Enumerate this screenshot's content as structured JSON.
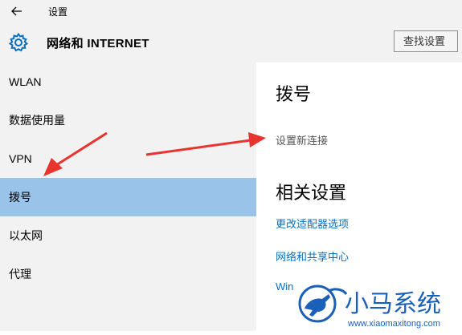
{
  "window": {
    "title": "设置"
  },
  "header": {
    "title": "网络和 INTERNET",
    "search_placeholder": "查找设置"
  },
  "sidebar": {
    "items": [
      {
        "label": "WLAN",
        "selected": false
      },
      {
        "label": "数据使用量",
        "selected": false
      },
      {
        "label": "VPN",
        "selected": false
      },
      {
        "label": "拨号",
        "selected": true
      },
      {
        "label": "以太网",
        "selected": false
      },
      {
        "label": "代理",
        "selected": false
      }
    ]
  },
  "main": {
    "section_title": "拨号",
    "setup_link": "设置新连接",
    "related_title": "相关设置",
    "related_links": [
      "更改适配器选项",
      "网络和共享中心",
      "Win"
    ]
  },
  "watermark": {
    "brand": "小马系统",
    "url": "www.xiaomaxitong.com"
  },
  "colors": {
    "selected_bg": "#99c3e8",
    "link": "#0a6ebd",
    "arrow": "#e8342f",
    "sidebar_bg": "#f2f2f2"
  },
  "icons": {
    "back": "arrow-left-icon",
    "settings": "gear-icon",
    "logo": "horse-logo-icon"
  }
}
